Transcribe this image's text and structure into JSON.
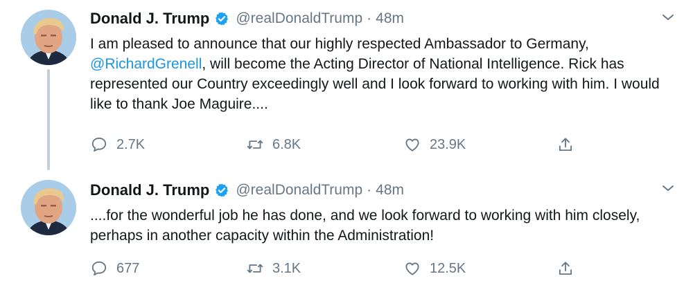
{
  "tweets": [
    {
      "display_name": "Donald J. Trump",
      "handle": "@realDonaldTrump",
      "separator": "·",
      "time": "48m",
      "text_before": "I am pleased to announce that our highly respected Ambassador to Germany,",
      "mention": "@RichardGrenell",
      "text_after": ", will become the Acting Director of National Intelligence. Rick has represented our Country exceedingly well and I look forward to working with him. I would like to thank Joe Maguire....",
      "replies": "2.7K",
      "retweets": "6.8K",
      "likes": "23.9K",
      "icons": [
        "verified-badge-icon",
        "chevron-down-icon",
        "reply-icon",
        "retweet-icon",
        "like-icon",
        "share-icon"
      ]
    },
    {
      "display_name": "Donald J. Trump",
      "handle": "@realDonaldTrump",
      "separator": "·",
      "time": "48m",
      "text": "....for the wonderful job he has done, and we look forward to working with him closely, perhaps in another capacity within the Administration!",
      "replies": "677",
      "retweets": "3.1K",
      "likes": "12.5K",
      "icons": [
        "verified-badge-icon",
        "chevron-down-icon",
        "reply-icon",
        "retweet-icon",
        "like-icon",
        "share-icon"
      ]
    }
  ],
  "colors": {
    "text": "#14171a",
    "secondary": "#657786",
    "link": "#1b95e0",
    "verified": "#1da1f2",
    "thread_line": "#c4ced6"
  }
}
